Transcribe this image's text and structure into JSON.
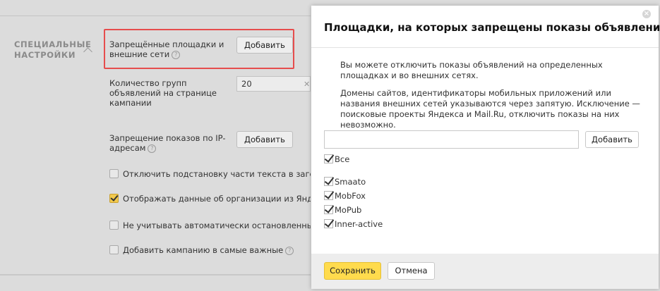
{
  "background": {
    "section_title": "СПЕЦИАЛЬНЫЕ НАСТРОЙКИ",
    "forbidden_sites": {
      "label": "Запрещённые площадки и внешние сети",
      "button": "Добавить"
    },
    "ad_groups": {
      "label": "Количество групп объявлений на странице кампании",
      "value": "20"
    },
    "ip_ban": {
      "label": "Запрещение показов по IP-адресам",
      "button": "Добавить"
    },
    "checkboxes": [
      {
        "label": "Отключить подстановку части текста в заголовок",
        "checked": false
      },
      {
        "label": "Отображать данные об организации из Яндекс.Справочника",
        "checked": true
      },
      {
        "label": "Не учитывать автоматически остановленные объявления",
        "checked": false
      },
      {
        "label": "Добавить кампанию в самые важные",
        "checked": false
      }
    ]
  },
  "modal": {
    "title": "Площадки, на которых запрещены показы объявлений",
    "description_1": "Вы можете отключить показы объявлений на определенных площадках и во внешних сетях.",
    "description_2": "Домены сайтов, идентификаторы мобильных приложений или названия внешних сетей указываются через запятую. Исключение — поисковые проекты Яндекса и Mail.Ru, отключить показы на них невозможно.",
    "input_value": "",
    "add_button": "Добавить",
    "all_label": "Все",
    "networks": [
      "Smaato",
      "MobFox",
      "MoPub",
      "Inner-active"
    ],
    "save_button": "Сохранить",
    "cancel_button": "Отмена"
  },
  "colors": {
    "accent_yellow": "#ffdb4d",
    "highlight_red": "#e64d4d"
  }
}
